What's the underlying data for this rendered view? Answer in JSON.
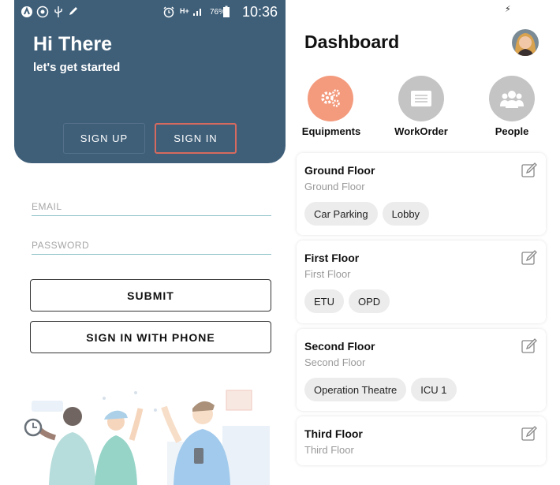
{
  "left": {
    "status_bar": {
      "time": "10:36",
      "battery": "76%",
      "network": "H+",
      "icons": [
        "app-icon",
        "whatsapp-icon",
        "usb-icon",
        "pen-icon",
        "alarm-icon",
        "signal-icon",
        "battery-icon"
      ]
    },
    "header": {
      "title": "Hi There",
      "subtitle": "let's get started",
      "background": "#3f5f79"
    },
    "tabs": {
      "sign_up": "SIGN UP",
      "sign_in": "SIGN IN",
      "active": "sign_in",
      "active_border": "#d76a5f"
    },
    "form": {
      "email": {
        "placeholder": "EMAIL",
        "value": ""
      },
      "password": {
        "placeholder": "PASSWORD",
        "value": ""
      },
      "submit_label": "SUBMIT",
      "phone_label": "SIGN IN WITH PHONE"
    }
  },
  "right": {
    "title": "Dashboard",
    "categories": [
      {
        "label": "Equipments",
        "icon": "gears-icon",
        "color": "#f49b7e",
        "active": true
      },
      {
        "label": "WorkOrder",
        "icon": "list-icon",
        "color": "#c4c4c4",
        "active": false
      },
      {
        "label": "People",
        "icon": "people-icon",
        "color": "#c4c4c4",
        "active": false
      }
    ],
    "floors": [
      {
        "name": "Ground Floor",
        "sub": "Ground Floor",
        "areas": [
          "Car Parking",
          "Lobby"
        ]
      },
      {
        "name": "First Floor",
        "sub": "First Floor",
        "areas": [
          "ETU",
          "OPD"
        ]
      },
      {
        "name": "Second Floor",
        "sub": "Second Floor",
        "areas": [
          "Operation Theatre",
          "ICU 1"
        ]
      },
      {
        "name": "Third Floor",
        "sub": "Third Floor",
        "areas": []
      }
    ]
  }
}
